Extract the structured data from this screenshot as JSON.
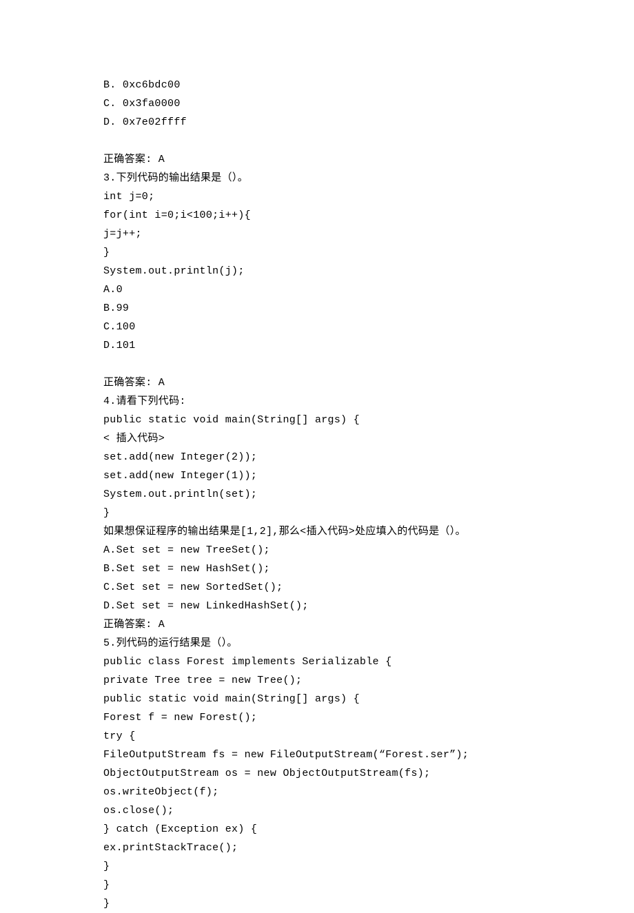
{
  "lines": [
    "B. 0xc6bdc00",
    "C. 0x3fa0000",
    "D. 0x7e02ffff",
    "",
    "正确答案: A",
    "3.下列代码的输出结果是（）。",
    "int j=0;",
    "for(int i=0;i<100;i++){",
    "j=j++;",
    "}",
    "System.out.println(j);",
    "A.0",
    "B.99",
    "C.100",
    "D.101",
    "",
    "正确答案: A",
    "4.请看下列代码:",
    "public static void main(String[] args) {",
    "< 插入代码>",
    "set.add(new Integer(2));",
    "set.add(new Integer(1));",
    "System.out.println(set);",
    "}",
    "如果想保证程序的输出结果是[1,2],那么<插入代码>处应填入的代码是（）。",
    "A.Set set = new TreeSet();",
    "B.Set set = new HashSet();",
    "C.Set set = new SortedSet();",
    "D.Set set = new LinkedHashSet();",
    "正确答案: A",
    "5.列代码的运行结果是（）。",
    "public class Forest implements Serializable {",
    "private Tree tree = new Tree();",
    "public static void main(String[] args) {",
    "Forest f = new Forest();",
    "try {",
    "FileOutputStream fs = new FileOutputStream(“Forest.ser”);",
    "ObjectOutputStream os = new ObjectOutputStream(fs);",
    "os.writeObject(f);",
    "os.close();",
    "} catch (Exception ex) {",
    "ex.printStackTrace();",
    "}",
    "}",
    "}"
  ]
}
